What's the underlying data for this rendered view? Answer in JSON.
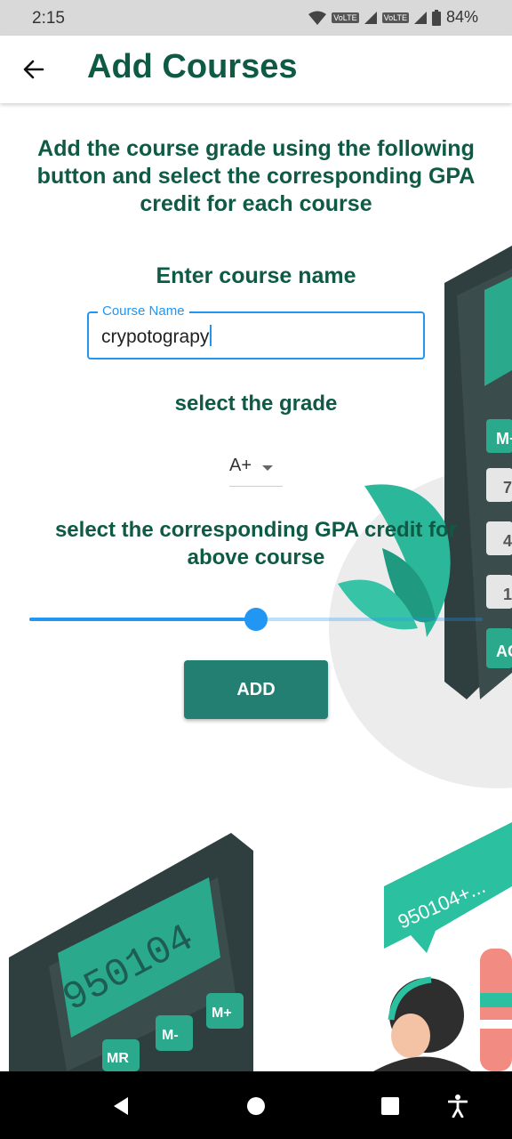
{
  "status_bar": {
    "time": "2:15",
    "sim1": "VoLTE",
    "sim2": "VoLTE",
    "battery": "84%"
  },
  "app_bar": {
    "title": "Add Courses",
    "back_icon": "arrow-back-icon"
  },
  "form": {
    "intro_text": "Add the course grade using the following button and select the corresponding GPA credit for each course",
    "course_name_heading": "Enter course name",
    "course_name_field": {
      "label": "Course Name",
      "value": "crypotograpy"
    },
    "grade_heading": "select the grade",
    "grade_dropdown": {
      "selected": "A+"
    },
    "credit_heading": "select the corresponding GPA credit for above course",
    "credit_slider": {
      "value_fraction": 0.5
    },
    "add_button_label": "ADD"
  },
  "background": {
    "calculator_display_text": "950104",
    "speech_bubble_text": "950104+...",
    "calculator_keys": [
      "M+",
      "M-",
      "MR",
      "7",
      "4",
      "1",
      "AC"
    ]
  },
  "nav_bar": {
    "icons": [
      "back-triangle-icon",
      "home-circle-icon",
      "recents-square-icon",
      "accessibility-icon"
    ]
  },
  "colors": {
    "accent_green": "#0e5a45",
    "button_teal": "#237f72",
    "primary_blue": "#2196f3"
  }
}
